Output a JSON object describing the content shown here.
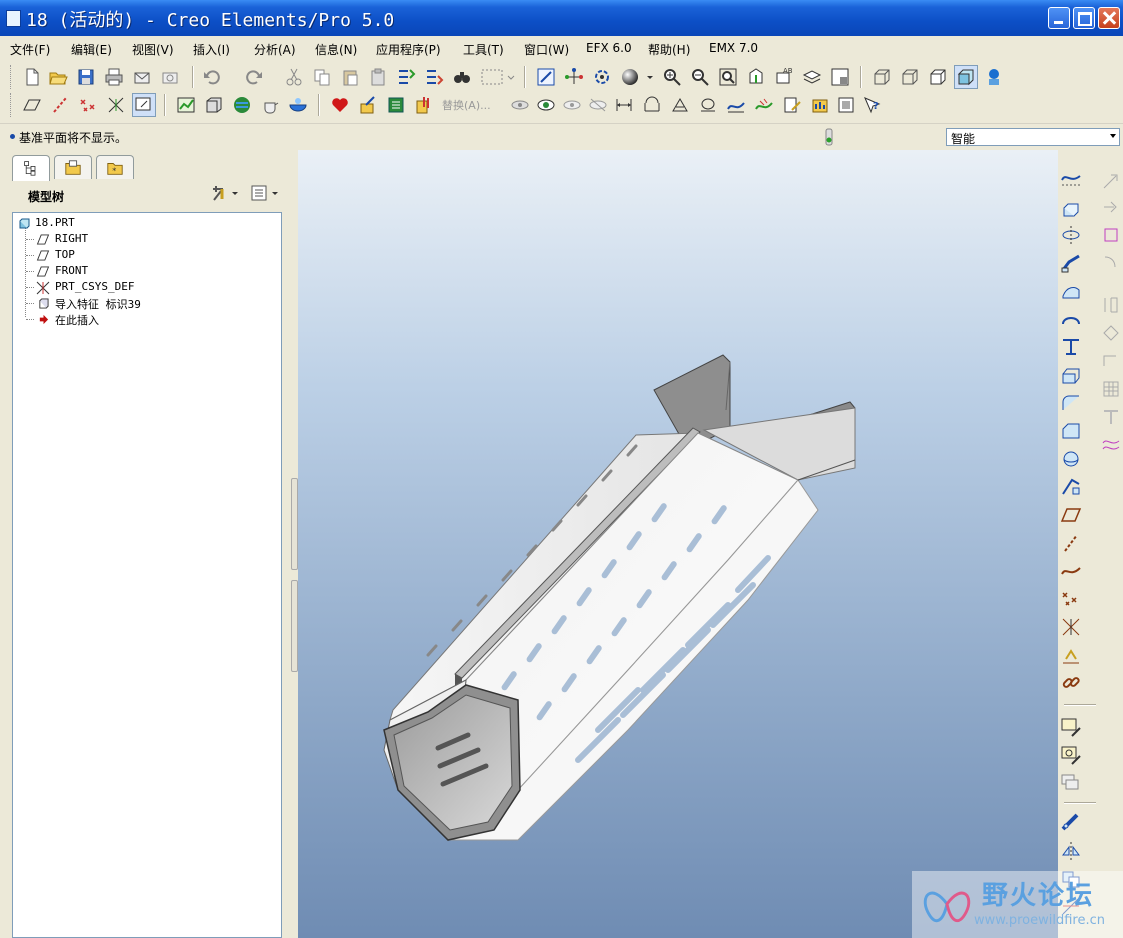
{
  "window": {
    "title": "18 (活动的) - Creo Elements/Pro 5.0"
  },
  "menu": {
    "items": [
      "文件(F)",
      "编辑(E)",
      "视图(V)",
      "插入(I)",
      "分析(A)",
      "信息(N)",
      "应用程序(P)",
      "工具(T)",
      "窗口(W)",
      "EFX 6.0",
      "帮助(H)",
      "EMX 7.0"
    ]
  },
  "toolbar": {
    "replace_label": "替换(A)..."
  },
  "message": {
    "text": "基准平面将不显示。"
  },
  "filter": {
    "value": "智能"
  },
  "navigator": {
    "title": "模型树",
    "tree": [
      {
        "label": "18.PRT",
        "icon": "part-icon"
      },
      {
        "label": "RIGHT",
        "icon": "datum-plane-icon"
      },
      {
        "label": "TOP",
        "icon": "datum-plane-icon"
      },
      {
        "label": "FRONT",
        "icon": "datum-plane-icon"
      },
      {
        "label": "PRT_CSYS_DEF",
        "icon": "csys-icon"
      },
      {
        "label": "导入特征 标识39",
        "icon": "import-feature-icon"
      },
      {
        "label": "在此插入",
        "icon": "insert-here-arrow-icon"
      }
    ]
  },
  "watermark": {
    "title": "野火论坛",
    "url": "www.proewildfire.cn"
  },
  "colors": {
    "title_bar": "#0c4fc6",
    "chrome": "#ece9d8",
    "viewport_top": "#eaf0f6",
    "viewport_bottom": "#6f8cb3",
    "model_face": "#f4f4f4",
    "model_edge": "#555555"
  }
}
